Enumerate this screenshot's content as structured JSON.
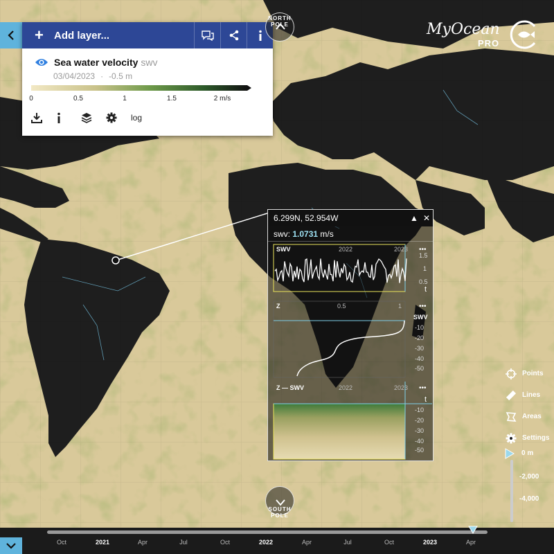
{
  "panel": {
    "add_layer_label": "Add layer...",
    "layer_name": "Sea water velocity",
    "layer_code": "swv",
    "date": "03/04/2023",
    "depth": "-0.5 m",
    "scale_ticks": [
      "0",
      "0.5",
      "1",
      "1.5",
      "2 m/s"
    ],
    "log_label": "log"
  },
  "logo": {
    "line1": "MyOcean",
    "line2": "PRO"
  },
  "poles": {
    "north": "NORTH POLE",
    "south": "SOUTH POLE"
  },
  "popup": {
    "coords": "6.299N, 52.954W",
    "value_label": "swv:",
    "value": "1.0731",
    "value_unit": "m/s",
    "plot1": {
      "var": "SWV",
      "years": [
        "2022",
        "2023"
      ],
      "y_ticks": [
        "1.5",
        "1",
        "0.5"
      ],
      "axis": "t"
    },
    "plot2": {
      "var": "Z",
      "x_ticks": [
        "0.5",
        "1"
      ],
      "series": "SWV",
      "depth_ticks": [
        "-10",
        "-20",
        "-30",
        "-40",
        "-50"
      ]
    },
    "plot3": {
      "var": "Z — SWV",
      "years": [
        "2022",
        "2023"
      ],
      "axis": "t",
      "depth_ticks": [
        "-10",
        "-20",
        "-30",
        "-40",
        "-50"
      ]
    }
  },
  "side_tools": [
    {
      "label": "Points",
      "icon": "crosshair-icon"
    },
    {
      "label": "Lines",
      "icon": "ruler-icon"
    },
    {
      "label": "Areas",
      "icon": "area-icon"
    },
    {
      "label": "Settings",
      "icon": "gear-icon"
    }
  ],
  "depth": {
    "labels": [
      "0 m",
      "-2,000",
      "-4,000"
    ]
  },
  "timeline": {
    "labels": [
      "Oct",
      "2021",
      "Apr",
      "Jul",
      "Oct",
      "2022",
      "Apr",
      "Jul",
      "Oct",
      "2023",
      "Apr"
    ]
  },
  "chart_data": {
    "type": "line",
    "series_name": "SWV",
    "x_years": [
      "2022",
      "2023"
    ],
    "y_ticks": [
      0.5,
      1,
      1.5
    ],
    "current_value": 1.0731,
    "unit": "m/s"
  },
  "colors": {
    "panel_header": "#2d4796",
    "accent": "#5fb3dc",
    "ocean": "#d9c99a",
    "land": "#1e1e1e"
  }
}
